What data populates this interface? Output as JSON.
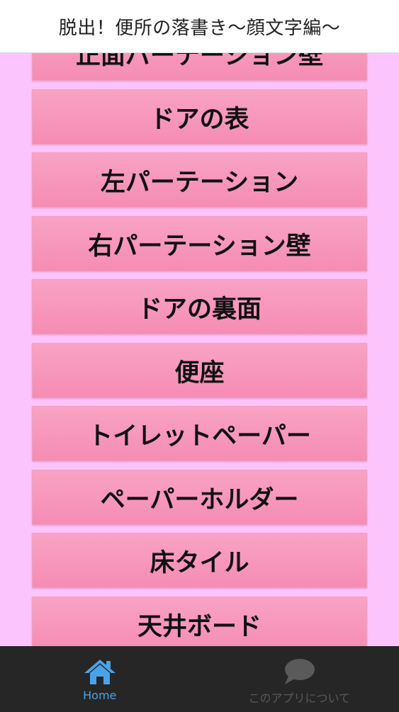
{
  "header": {
    "title": "脱出！便所の落書き〜顔文字編〜"
  },
  "menu": {
    "items": [
      {
        "label": "正面パーテーション壁"
      },
      {
        "label": "ドアの表"
      },
      {
        "label": "左パーテーション"
      },
      {
        "label": "右パーテーション壁"
      },
      {
        "label": "ドアの裏面"
      },
      {
        "label": "便座"
      },
      {
        "label": "トイレットペーパー"
      },
      {
        "label": "ペーパーホルダー"
      },
      {
        "label": "床タイル"
      },
      {
        "label": "天井ボード"
      }
    ]
  },
  "nav": {
    "home": {
      "label": "Home",
      "icon": "home-icon",
      "color": "#4aa3e8"
    },
    "about": {
      "label": "このアプリについて",
      "icon": "speech-bubble-icon",
      "color": "#5a5a5a"
    }
  }
}
